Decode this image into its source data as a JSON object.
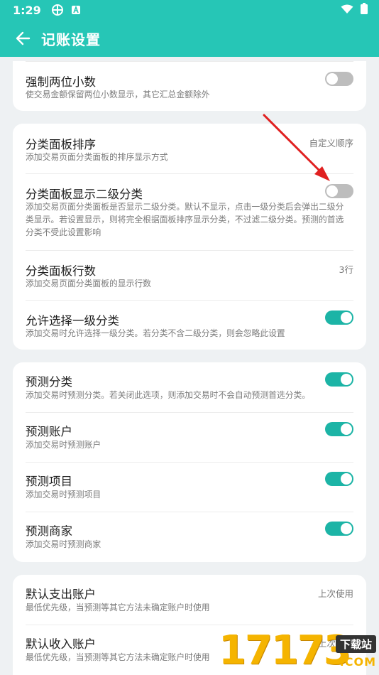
{
  "status_bar": {
    "time": "1:29",
    "icons": [
      "app-shortcut-icon",
      "a-badge-icon"
    ],
    "right_icons": [
      "wifi-icon",
      "battery-icon"
    ]
  },
  "app_bar": {
    "title": "记账设置",
    "back_icon": "arrow-left-icon"
  },
  "cards": [
    {
      "items": [
        {
          "title": "强制两位小数",
          "desc": "使交易金额保留两位小数显示，其它汇总金额除外",
          "toggle": false
        }
      ]
    },
    {
      "items": [
        {
          "title": "分类面板排序",
          "desc": "添加交易页面分类面板的排序显示方式",
          "value": "自定义顺序"
        },
        {
          "title": "分类面板显示二级分类",
          "desc": "添加交易页面分类面板是否显示二级分类。默认不显示，点击一级分类后会弹出二级分类显示。若设置显示，则将完全根据面板排序显示分类，不过滤二级分类。预测的首选分类不受此设置影响",
          "toggle": false
        },
        {
          "title": "分类面板行数",
          "desc": "添加交易页面分类面板的显示行数",
          "value": "3行"
        },
        {
          "title": "允许选择一级分类",
          "desc": "添加交易时允许选择一级分类。若分类不含二级分类，则会忽略此设置",
          "toggle": true
        }
      ]
    },
    {
      "items": [
        {
          "title": "预测分类",
          "desc": "添加交易时预测分类。若关闭此选项，则添加交易时不会自动预测首选分类。",
          "toggle": true
        },
        {
          "title": "预测账户",
          "desc": "添加交易时预测账户",
          "toggle": true
        },
        {
          "title": "预测项目",
          "desc": "添加交易时预测项目",
          "toggle": true
        },
        {
          "title": "预测商家",
          "desc": "添加交易时预测商家",
          "toggle": true
        }
      ]
    },
    {
      "items": [
        {
          "title": "默认支出账户",
          "desc": "最低优先级，当预测等其它方法未确定账户时使用",
          "value": "上次使用"
        },
        {
          "title": "默认收入账户",
          "desc": "最低优先级，当预测等其它方法未确定账户时使用",
          "value": "上次使用"
        }
      ]
    }
  ],
  "watermark": {
    "digits": "17173",
    "site": "下载站",
    "domain": ".COM"
  },
  "colors": {
    "accent": "#26c6b6",
    "toggle_on": "#1cb4a6",
    "toggle_off": "#bdbdbd",
    "annotation_arrow": "#e02020"
  }
}
